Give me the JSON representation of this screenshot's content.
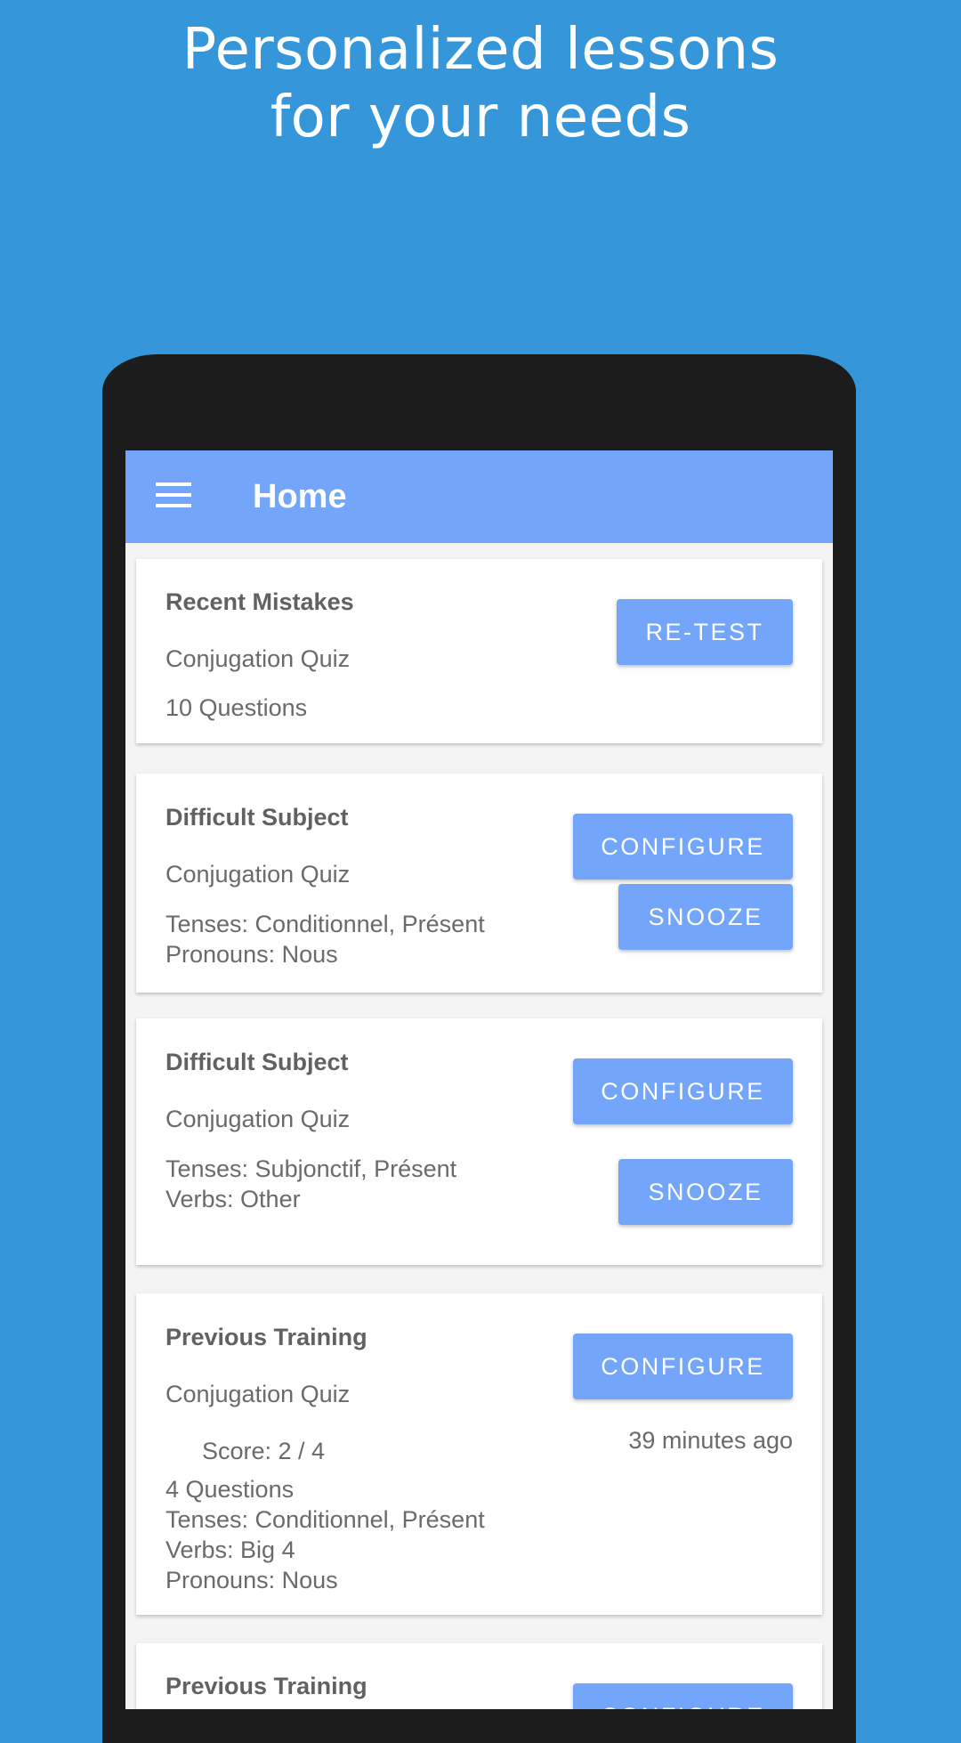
{
  "promo": {
    "headline_line1": "Personalized lessons",
    "headline_line2": "for your needs"
  },
  "appbar": {
    "title": "Home",
    "menu_icon": "hamburger-menu-icon"
  },
  "cards": [
    {
      "title": "Recent Mistakes",
      "subtitle": "Conjugation Quiz",
      "line1": "10 Questions",
      "primary_button": "RE-TEST"
    },
    {
      "title": "Difficult Subject",
      "subtitle": "Conjugation Quiz",
      "line1": "Tenses: Conditionnel, Présent",
      "line2": "Pronouns: Nous",
      "primary_button": "CONFIGURE",
      "secondary_button": "SNOOZE"
    },
    {
      "title": "Difficult Subject",
      "subtitle": "Conjugation Quiz",
      "line1": "Tenses: Subjonctif, Présent",
      "line2": "Verbs: Other",
      "primary_button": "CONFIGURE",
      "secondary_button": "SNOOZE"
    },
    {
      "title": "Previous Training",
      "subtitle": "Conjugation Quiz",
      "score": "Score: 2 / 4",
      "line1": "4 Questions",
      "line2": "Tenses: Conditionnel, Présent",
      "line3": "Verbs: Big 4",
      "line4": "Pronouns: Nous",
      "primary_button": "CONFIGURE",
      "time_ago": "39 minutes ago"
    },
    {
      "title": "Previous Training",
      "primary_button": "CONFIGURE"
    }
  ],
  "colors": {
    "background": "#3596d9",
    "appbar": "#73a5fb",
    "button": "#73a5fb",
    "phone_frame": "#1c1c1c"
  }
}
